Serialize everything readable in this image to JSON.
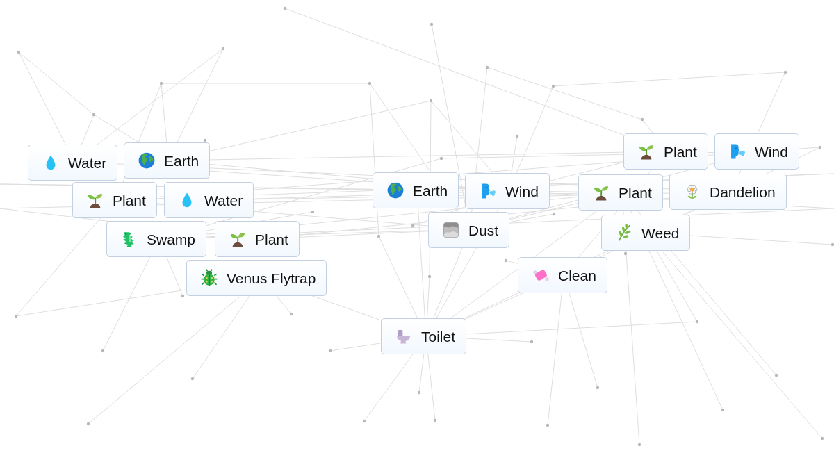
{
  "canvas": {
    "elements": [
      {
        "label": "Water",
        "kind": "droplet"
      },
      {
        "label": "Earth",
        "kind": "globe"
      },
      {
        "label": "Plant",
        "kind": "seedling"
      },
      {
        "label": "Water",
        "kind": "droplet"
      },
      {
        "label": "Swamp",
        "kind": "crocodile"
      },
      {
        "label": "Plant",
        "kind": "seedling"
      },
      {
        "label": "Venus Flytrap",
        "kind": "beetle"
      },
      {
        "label": "Earth",
        "kind": "globe"
      },
      {
        "label": "Wind",
        "kind": "wind"
      },
      {
        "label": "Dust",
        "kind": "cloud"
      },
      {
        "label": "Clean",
        "kind": "soap"
      },
      {
        "label": "Toilet",
        "kind": "toilet"
      },
      {
        "label": "Plant",
        "kind": "seedling"
      },
      {
        "label": "Wind",
        "kind": "wind"
      },
      {
        "label": "Plant",
        "kind": "seedling"
      },
      {
        "label": "Dandelion",
        "kind": "flower"
      },
      {
        "label": "Weed",
        "kind": "herb"
      }
    ]
  }
}
